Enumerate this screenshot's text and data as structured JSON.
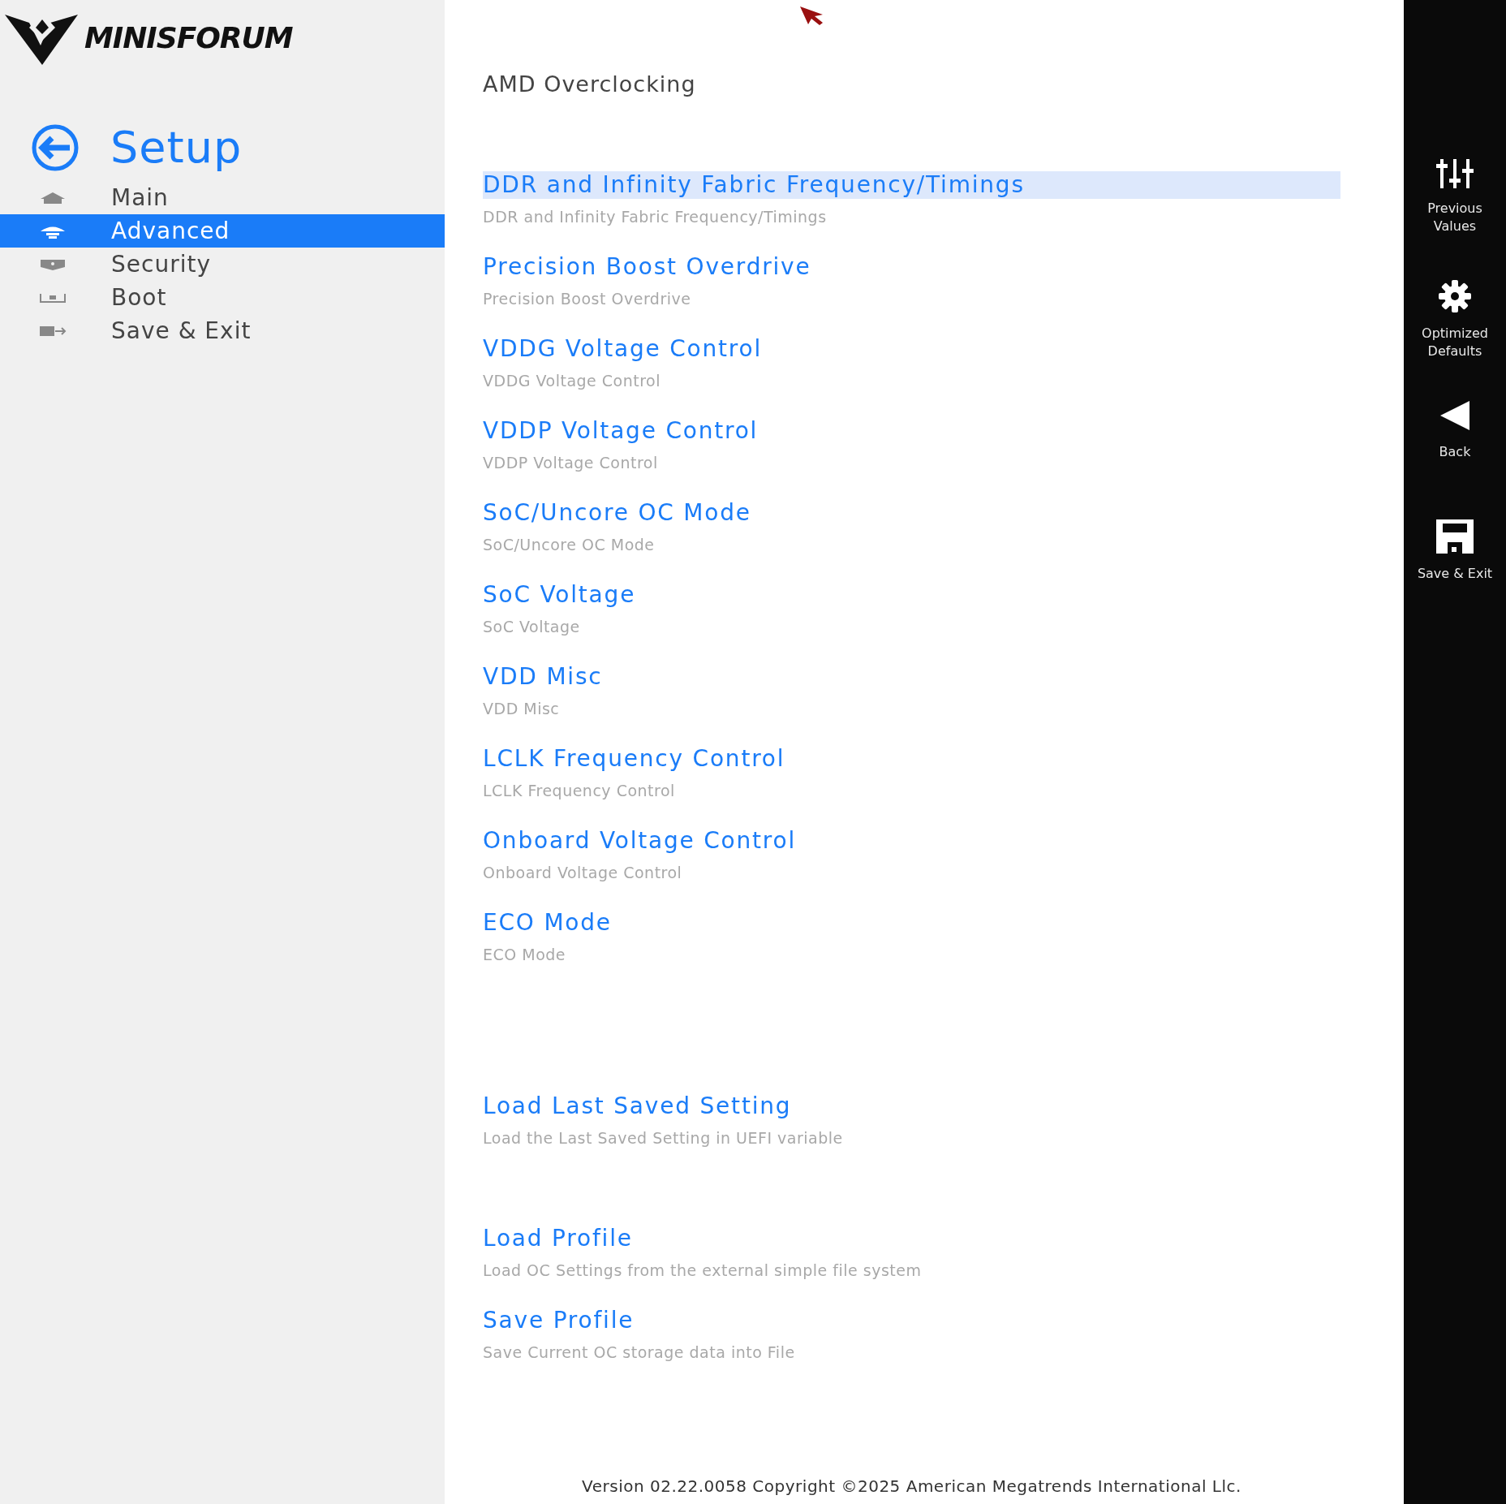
{
  "logo": {
    "text": "MINISFORUM"
  },
  "sidebar": {
    "title": "Setup",
    "items": [
      {
        "label": "Main",
        "kind": "home",
        "selected": false
      },
      {
        "label": "Advanced",
        "kind": "advanced",
        "selected": true
      },
      {
        "label": "Security",
        "kind": "security",
        "selected": false
      },
      {
        "label": "Boot",
        "kind": "boot",
        "selected": false
      },
      {
        "label": "Save & Exit",
        "kind": "exit",
        "selected": false
      }
    ]
  },
  "page": {
    "title": "AMD Overclocking",
    "groups": [
      [
        {
          "title": "DDR and Infinity Fabric Frequency/Timings",
          "description": "DDR and Infinity Fabric Frequency/Timings",
          "selected": true
        },
        {
          "title": "Precision Boost Overdrive",
          "description": "Precision Boost Overdrive",
          "selected": false
        },
        {
          "title": "VDDG Voltage Control",
          "description": "VDDG Voltage Control",
          "selected": false
        },
        {
          "title": "VDDP Voltage Control",
          "description": "VDDP Voltage Control",
          "selected": false
        },
        {
          "title": "SoC/Uncore OC Mode",
          "description": "SoC/Uncore OC Mode",
          "selected": false
        },
        {
          "title": "SoC Voltage",
          "description": "SoC Voltage",
          "selected": false
        },
        {
          "title": "VDD Misc",
          "description": "VDD Misc",
          "selected": false
        },
        {
          "title": "LCLK Frequency Control",
          "description": "LCLK Frequency Control",
          "selected": false
        },
        {
          "title": "Onboard Voltage Control",
          "description": "Onboard Voltage Control",
          "selected": false
        },
        {
          "title": "ECO Mode",
          "description": "ECO Mode",
          "selected": false
        }
      ],
      [
        {
          "title": "Load Last Saved Setting",
          "description": "Load the Last Saved Setting in UEFI variable",
          "selected": false
        }
      ],
      [
        {
          "title": "Load Profile",
          "description": "Load OC Settings from the external simple file system",
          "selected": false
        },
        {
          "title": "Save Profile",
          "description": "Save Current OC storage data into File",
          "selected": false
        }
      ]
    ],
    "footer": "Version 02.22.0058 Copyright ©2025 American Megatrends International Llc."
  },
  "toolbar": [
    {
      "label": "Previous\nValues",
      "kind": "sliders"
    },
    {
      "label": "Optimized\nDefaults",
      "kind": "gear"
    },
    {
      "label": "Back",
      "kind": "back"
    },
    {
      "label": "Save & Exit",
      "kind": "save"
    }
  ]
}
